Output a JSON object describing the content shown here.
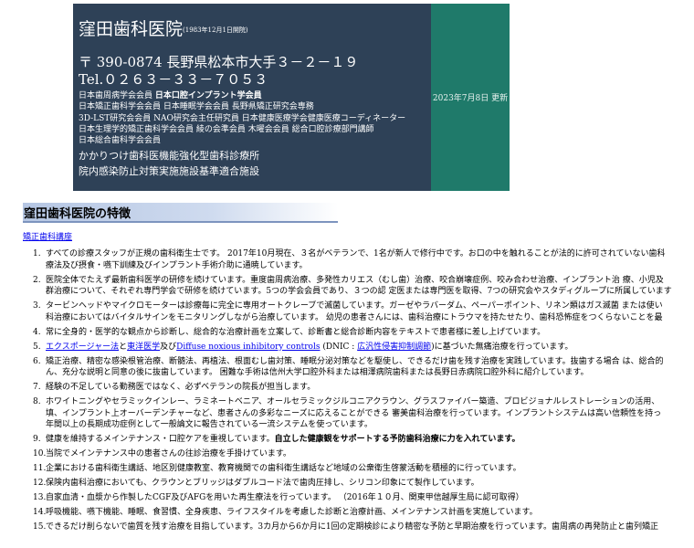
{
  "header": {
    "clinic_name": "窪田歯科医院",
    "established": "(1983年12月1日開院)",
    "address": "〒 390-0874 長野県松本市大手３－２－１９",
    "tel": "Tel.０２６３－３３－７０５３",
    "memberships": [
      [
        "日本歯周病学会会員 ",
        "日本口腔インプラント学会員"
      ],
      [
        "日本矯正歯科学会会員 日本睡眠学会会員 長野県矯正研究会専務"
      ],
      [
        "3D-LST研究会会員 NAO研究会主任研究員 日本健康医療学会健康医療コーディネーター"
      ],
      [
        "日本生理学的矯正歯科学会会員 綾の会準会員 木曜会会員 総合口腔診療部門講師"
      ],
      [
        "日本総合歯科学会会員"
      ]
    ],
    "subtitle1": "かかりつけ歯科医機能強化型歯科診療所",
    "subtitle2": "院内感染防止対策実施施設基準適合施設",
    "updated": "2023年7月8日 更新"
  },
  "section": {
    "title": "窪田歯科医院の特徴",
    "link": "矯正歯科講座"
  },
  "features": [
    {
      "num": "1.",
      "lines": [
        "すべての診療スタッフが正規の歯科衛生士です。 2017年10月現在、３名がベテランで、1名が新人で修行中です。お口の中を触れることが法的に許可されていない歯科",
        "療法及び摂食・嚥下訓練及びインプラント手術介助に通暁しています。"
      ]
    },
    {
      "num": "2.",
      "lines": [
        "医院全体でたえず最新歯科医学の研修を続けています。重度歯周病治療、多発性カリエス（むし歯）治療、咬合崩壊症例、咬み合わせ治療、インプラント治 療、小児及",
        "群治療について、それぞれ専門学会で研修を続けています。5つの学会会員であり、３つの認 定医または専門医を取得、7つの研究会やスタディグループに所属しています"
      ]
    },
    {
      "num": "3.",
      "lines": [
        "タービンヘッドやマイクロモーターは診療毎に完全に専用オートクレーブで滅菌しています。ガーゼやラバーダム、ペーパーポイント、リネン類はガス滅菌 または使い",
        "科治療においてはバイタルサインをモニタリングしながら治療しています。 幼児の患者さんには、歯科治療にトラウマを持たせたり、歯科恐怖症をつくらないことを最"
      ]
    },
    {
      "num": "4.",
      "lines": [
        "常に全身的・医学的な観点から診断し、総合的な治療計画を立案して、診断書と総合診断内容をテキストで患者様に差し上げています。"
      ]
    },
    {
      "num": "5.",
      "lines": [],
      "rich": [
        [
          "link",
          "エクスポージャー法"
        ],
        [
          "text",
          "と"
        ],
        [
          "link",
          "東洋医学"
        ],
        [
          "text",
          "及び"
        ],
        [
          "link",
          "Diffuse noxious inhibitory controls"
        ],
        [
          "text",
          " (DNIC : "
        ],
        [
          "link",
          "広汎性侵害抑制調節"
        ],
        [
          "text",
          ")に基づいた無痛治療を行っています。"
        ]
      ]
    },
    {
      "num": "6.",
      "lines": [
        "矯正治療、精密な感染根管治療、断髄法、再植法、根面むし歯対策、睡眠分泌対策などを駆使し、できるだけ歯を残す治療を実践しています。抜歯する場合 は、総合的",
        "ん、充分な説明と同意の後に抜歯しています。 困難な手術は信州大学口腔外科または相澤病院歯科または長野日赤病院口腔外科に紹介しています。"
      ]
    },
    {
      "num": "7.",
      "lines": [
        "経験の不足している勤務医ではなく、必ずベテランの院長が担当します。"
      ]
    },
    {
      "num": "8.",
      "lines": [
        "ホワイトニングやセラミックインレー、ラミネートベニア、オールセラミックジルコニアクラウン、グラスファイバー築造、プロビジョナルレストレーションの活用、",
        "填、インプラント上オーバーデンチャーなど、患者さんの多彩なニーズに応えることができる 審美歯科治療を行っています。インプラントシステムは高い信頼性を持っ",
        "年間以上の長期成功症例として一般論文に報告されている一流システムを使っています。"
      ]
    },
    {
      "num": "9.",
      "lines": [],
      "rich": [
        [
          "text",
          "健康を維持するメインテナンス・口腔ケアを重視しています。"
        ],
        [
          "bold",
          "自立した健康観をサポートする予防歯科治療に力を入れています。"
        ]
      ]
    },
    {
      "num": "10.",
      "lines": [
        "当院でメインテナンス中の患者さんの往診治療を手掛けています。"
      ]
    },
    {
      "num": "11.",
      "lines": [
        "企業における歯科衛生講話、地区別健康教室、教育機関での歯科衛生講話など地域の公衆衛生啓蒙活動を積極的に行っています。"
      ]
    },
    {
      "num": "12.",
      "lines": [
        "保険内歯科治療においても、クラウンとブリッジはダブルコード法で歯肉圧排し、シリコン印象にて製作しています。"
      ]
    },
    {
      "num": "13.",
      "lines": [
        "自家血清・血漿から作製したCGF及びAFGを用いた再生療法を行っています。 （2016年１０月、関東甲信越厚生局に認可取得）"
      ]
    },
    {
      "num": "14.",
      "lines": [
        "呼吸機能、嚥下機能、睡眠、食習慣、全身疾患、ライフスタイルを考慮した診断と治療計画、メインテナンス計画を実施しています。"
      ]
    },
    {
      "num": "15.",
      "lines": [
        "できるだけ削らないで歯質を残す治療を目指しています。3カ月から6か月に1回の定期検診により精密な予防と早期治療を行っています。歯周病の再発防止と歯列矯正"
      ]
    }
  ]
}
